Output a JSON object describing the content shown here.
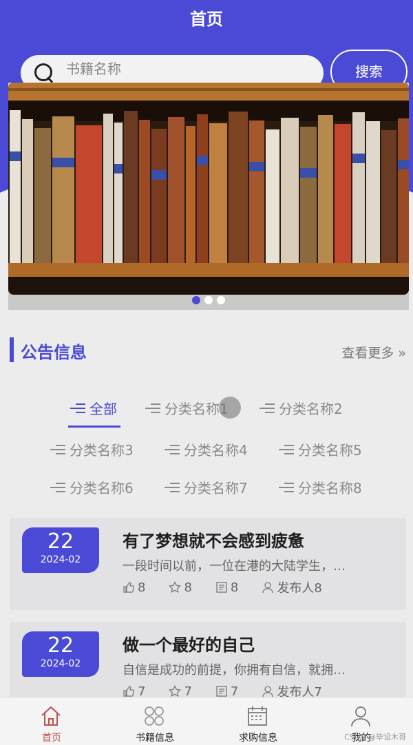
{
  "header": {
    "title": "首页"
  },
  "search": {
    "placeholder": "书籍名称",
    "button_label": "搜索"
  },
  "banner": {
    "dots": 3,
    "active_dot": 1
  },
  "notice": {
    "title": "公告信息",
    "more_label": "查看更多 »"
  },
  "categories": [
    {
      "label": "全部",
      "active": true
    },
    {
      "label": "分类名称1"
    },
    {
      "label": "分类名称2"
    },
    {
      "label": "分类名称3"
    },
    {
      "label": "分类名称4"
    },
    {
      "label": "分类名称5"
    },
    {
      "label": "分类名称6"
    },
    {
      "label": "分类名称7"
    },
    {
      "label": "分类名称8"
    }
  ],
  "cards": [
    {
      "day": "22",
      "ym": "2024-02",
      "title": "有了梦想就不会感到疲惫",
      "desc": "一段时间以前，一位在港的大陆学生，…",
      "likes": "8",
      "stars": "8",
      "views": "8",
      "publisher": "发布人8"
    },
    {
      "day": "22",
      "ym": "2024-02",
      "title": "做一个最好的自己",
      "desc": "自信是成功的前提，你拥有自信，就拥…",
      "likes": "7",
      "stars": "7",
      "views": "7",
      "publisher": "发布人7"
    }
  ],
  "tabbar": {
    "items": [
      {
        "label": "首页",
        "icon": "home-icon",
        "active": true
      },
      {
        "label": "书籍信息",
        "icon": "grid-icon"
      },
      {
        "label": "求购信息",
        "icon": "calendar-icon"
      },
      {
        "label": "我的",
        "icon": "user-icon"
      }
    ]
  },
  "watermark": "CSDN @毕设木哥",
  "colors": {
    "primary": "#4b4ad7",
    "active_tab": "#c0504d"
  }
}
